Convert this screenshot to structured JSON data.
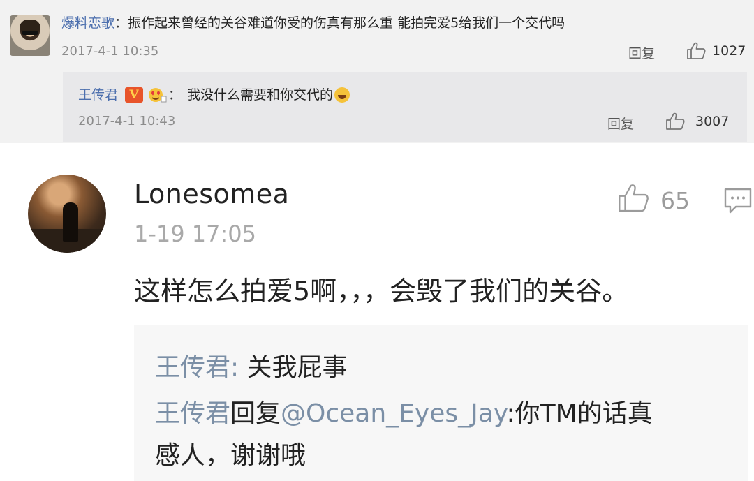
{
  "top_comment": {
    "user": "爆料恋歌",
    "colon": "：",
    "text": "振作起来曾经的关谷难道你受的伤真有那么重 能拍完爱5给我们一个交代吗",
    "date": "2017-4-1 10:35",
    "reply_label": "回复",
    "likes": "1027",
    "icons": [
      "avatar",
      "thumbs-up-icon"
    ]
  },
  "sub_reply": {
    "user": "王传君",
    "badge": "V",
    "colon": "：",
    "text": "我没什么需要和你交代的",
    "date": "2017-4-1 10:43",
    "reply_label": "回复",
    "likes": "3007",
    "icons": [
      "verified-icon",
      "heart-eyes-badge-icon",
      "laughing-emoji-icon",
      "thumbs-up-icon"
    ]
  },
  "bottom_comment": {
    "user": "Lonesomea",
    "date": "1-19 17:05",
    "likes": "65",
    "text": "这样怎么拍爱5啊，，，会毁了我们的关谷。",
    "icons": [
      "avatar",
      "thumbs-up-icon",
      "comment-icon"
    ],
    "replies": [
      {
        "user": "王传君",
        "sep": ": ",
        "text": "关我屁事"
      },
      {
        "user": "王传君",
        "reply_word": "回复",
        "mention": "@Ocean_Eyes_Jay",
        "sep": ":",
        "text_line1": "你TM的话真",
        "text_line2": "感人，谢谢哦"
      }
    ]
  },
  "colors": {
    "username_link": "#4c6fae",
    "quote_username": "#7b8fa6",
    "top_bg": "#f2f2f2",
    "subreply_bg": "#e8e8ea",
    "verified_badge": "#e8542a"
  }
}
